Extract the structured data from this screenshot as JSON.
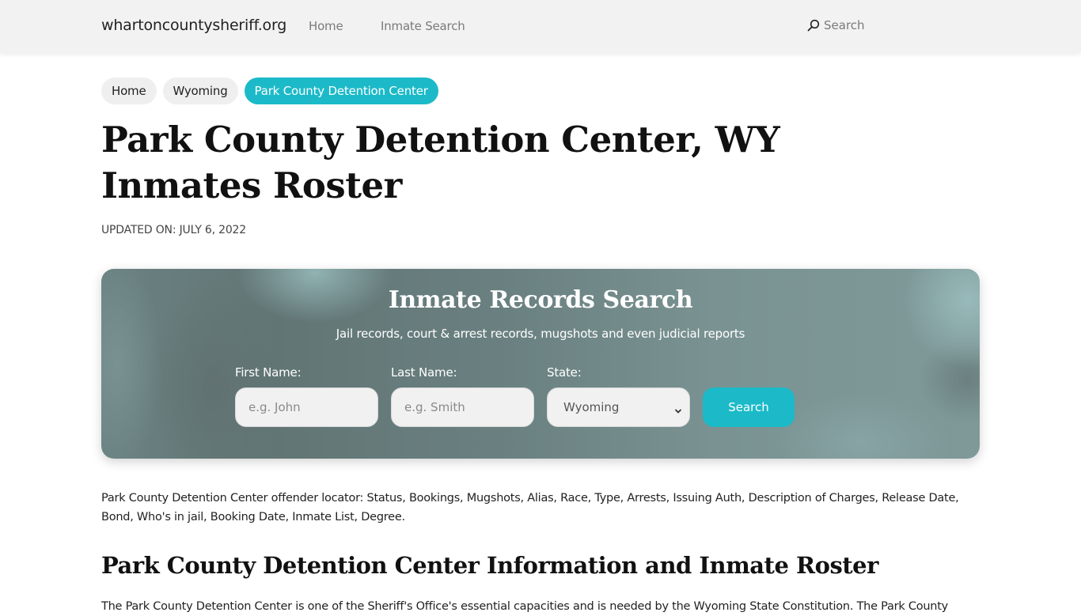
{
  "navbar": {
    "brand": "whartoncountysheriff.org",
    "links": [
      {
        "label": "Home"
      },
      {
        "label": "Inmate Search"
      }
    ],
    "search_label": "Search",
    "search_icon": "search-icon"
  },
  "breadcrumb": [
    {
      "label": "Home"
    },
    {
      "label": "Wyoming"
    },
    {
      "label": "Park County Detention Center",
      "active": true
    }
  ],
  "page": {
    "title": "Park County Detention Center, WY Inmates Roster",
    "updated": "UPDATED ON: JULY 6, 2022"
  },
  "search_card": {
    "title": "Inmate Records Search",
    "subtitle": "Jail records, court & arrest records, mugshots and even judicial reports",
    "first_name": {
      "label": "First Name:",
      "placeholder": "e.g. John",
      "value": ""
    },
    "last_name": {
      "label": "Last Name:",
      "placeholder": "e.g. Smith",
      "value": ""
    },
    "state": {
      "label": "State:",
      "selected": "Wyoming"
    },
    "button_label": "Search"
  },
  "content": {
    "intro": "Park County Detention Center offender locator: Status, Bookings, Mugshots, Alias, Race, Type, Arrests, Issuing Auth, Description of Charges, Release Date, Bond, Who's in jail, Booking Date, Inmate List, Degree.",
    "section_heading": "Park County Detention Center Information and Inmate Roster",
    "section_body": "The Park County Detention Center is one of the Sheriff's Office's essential capacities and is needed by the Wyoming State Constitution. The Park County"
  },
  "colors": {
    "accent": "#1cbac8",
    "navbar_bg": "#f2f2f2",
    "card_bg": "#6b8282"
  }
}
